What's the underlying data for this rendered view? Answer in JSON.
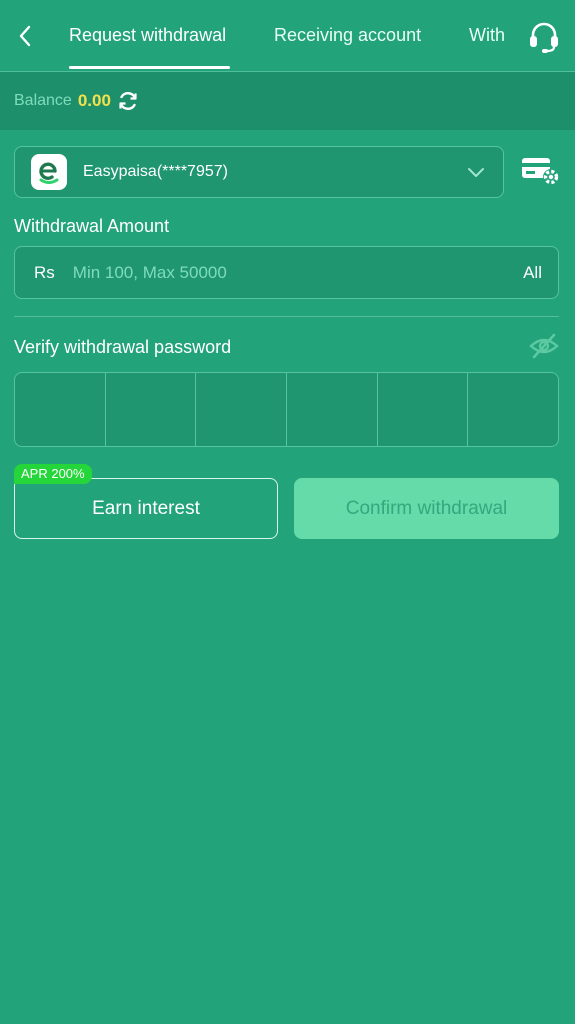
{
  "header": {
    "tabs": [
      {
        "label": "Request withdrawal",
        "active": true
      },
      {
        "label": "Receiving account",
        "active": false
      },
      {
        "label": "With",
        "active": false
      }
    ]
  },
  "balance": {
    "label": "Balance",
    "value": "0.00"
  },
  "account": {
    "name": "Easypaisa(****7957)"
  },
  "amount": {
    "label": "Withdrawal Amount",
    "currency": "Rs",
    "placeholder": "Min 100, Max 50000",
    "all_label": "All"
  },
  "password": {
    "label": "Verify withdrawal password",
    "cells": 6
  },
  "actions": {
    "earn_badge": "APR 200%",
    "earn_label": "Earn interest",
    "confirm_label": "Confirm withdrawal"
  },
  "colors": {
    "background": "#23a37a",
    "balance_value": "#f4e24a",
    "badge": "#25d63a",
    "confirm_bg": "#64dba9"
  }
}
